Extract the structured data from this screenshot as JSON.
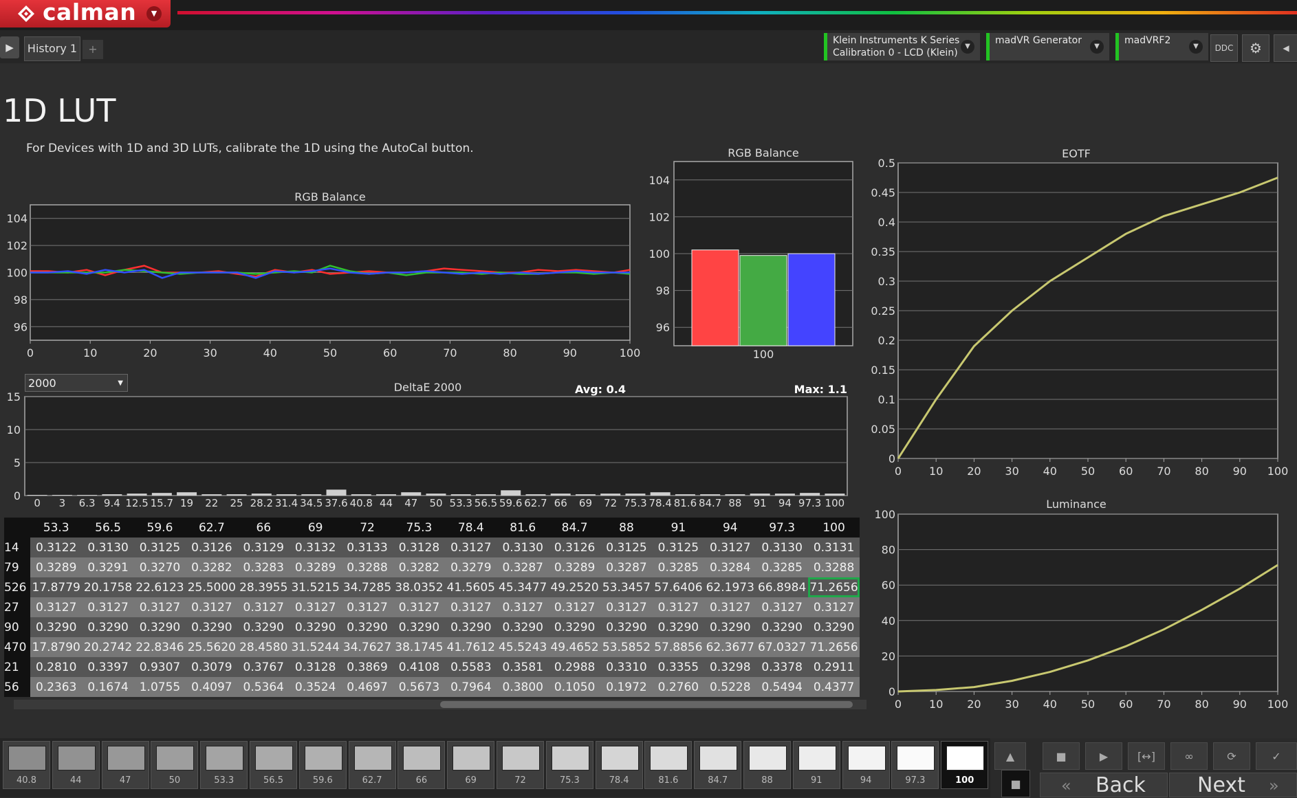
{
  "app": {
    "name": "calman",
    "history_tab": "History 1",
    "add_tab": "+",
    "devices": [
      {
        "line1": "Klein Instruments K Series",
        "line2": "Calibration 0 - LCD (Klein)"
      },
      {
        "line1": "madVR Generator",
        "line2": ""
      },
      {
        "line1": "madVRF2",
        "line2": ""
      }
    ],
    "ddc_label": "DDC"
  },
  "page": {
    "title": "1D LUT",
    "subtitle": "For Devices with 1D and 3D LUTs, calibrate the 1D using the AutoCal button."
  },
  "colors": {
    "accent": "#22c322",
    "red": "#ff4444",
    "green": "#44aa44",
    "blue": "#4444ff",
    "curve": "#c8c870"
  },
  "chart_data": [
    {
      "type": "line",
      "title": "RGB Balance",
      "x": [
        0,
        3,
        6.3,
        9.4,
        12.5,
        15.7,
        19,
        22,
        25,
        28.2,
        31.4,
        34.5,
        37.6,
        40.8,
        44,
        47,
        50,
        53.3,
        56.5,
        59.6,
        62.7,
        66,
        69,
        72,
        75.3,
        78.4,
        81.6,
        84.7,
        88,
        91,
        94,
        97.3,
        100
      ],
      "series": [
        {
          "name": "Red",
          "color": "#ff3030",
          "values": [
            100.1,
            100.1,
            100.0,
            100.2,
            99.8,
            100.2,
            100.5,
            100.0,
            100.0,
            100.0,
            100.1,
            99.9,
            99.7,
            100.2,
            100.0,
            100.2,
            99.9,
            100.0,
            100.1,
            100.0,
            100.0,
            100.1,
            100.3,
            100.2,
            100.1,
            100.0,
            100.0,
            100.2,
            100.1,
            100.2,
            100.1,
            100.0,
            100.2
          ]
        },
        {
          "name": "Green",
          "color": "#30c030",
          "values": [
            100.0,
            100.0,
            100.0,
            100.0,
            100.0,
            100.2,
            100.1,
            100.0,
            99.9,
            100.0,
            100.0,
            100.0,
            99.9,
            100.0,
            100.1,
            100.0,
            100.5,
            100.1,
            99.9,
            100.0,
            99.8,
            100.0,
            100.0,
            100.0,
            99.9,
            100.0,
            99.9,
            99.9,
            100.0,
            100.0,
            99.9,
            100.0,
            99.9
          ]
        },
        {
          "name": "Blue",
          "color": "#3050ff",
          "values": [
            100.0,
            100.0,
            100.1,
            99.9,
            100.2,
            100.0,
            100.2,
            99.6,
            100.0,
            100.0,
            100.0,
            100.0,
            99.6,
            100.1,
            100.0,
            100.1,
            100.3,
            100.0,
            99.9,
            100.0,
            100.0,
            100.1,
            100.0,
            99.9,
            100.0,
            99.9,
            100.0,
            99.9,
            100.0,
            100.1,
            100.0,
            100.0,
            100.0
          ]
        }
      ],
      "ylim": [
        95,
        105
      ],
      "yticks": [
        96,
        98,
        100,
        102,
        104
      ],
      "xlim": [
        0,
        100
      ],
      "xticks": [
        0,
        10,
        20,
        30,
        40,
        50,
        60,
        70,
        80,
        90,
        100
      ]
    },
    {
      "type": "bar",
      "title": "RGB Balance",
      "categories": [
        "100"
      ],
      "series": [
        {
          "name": "Red",
          "color": "#ff4444",
          "values": [
            100.2
          ]
        },
        {
          "name": "Green",
          "color": "#44aa44",
          "values": [
            99.9
          ]
        },
        {
          "name": "Blue",
          "color": "#4444ff",
          "values": [
            100.0
          ]
        }
      ],
      "ylim": [
        95,
        105
      ],
      "yticks": [
        96,
        98,
        100,
        102,
        104
      ]
    },
    {
      "type": "bar",
      "title": "DeltaE 2000",
      "avg_label": "Avg: 0.4",
      "max_label": "Max: 1.1",
      "categories": [
        "0",
        "3",
        "6.3",
        "9.4",
        "12.5",
        "15.7",
        "19",
        "22",
        "25",
        "28.2",
        "31.4",
        "34.5",
        "37.6",
        "40.8",
        "44",
        "47",
        "50",
        "53.3",
        "56.5",
        "59.6",
        "62.7",
        "66",
        "69",
        "72",
        "75.3",
        "78.4",
        "81.6",
        "84.7",
        "88",
        "91",
        "94",
        "97.3",
        "100"
      ],
      "values": [
        0.1,
        0.1,
        0.1,
        0.2,
        0.3,
        0.4,
        0.5,
        0.2,
        0.2,
        0.3,
        0.2,
        0.2,
        0.9,
        0.2,
        0.2,
        0.5,
        0.3,
        0.2,
        0.2,
        0.8,
        0.2,
        0.3,
        0.2,
        0.3,
        0.3,
        0.5,
        0.2,
        0.2,
        0.2,
        0.3,
        0.3,
        0.4,
        0.3
      ],
      "ylim": [
        0,
        15
      ],
      "yticks": [
        0,
        5,
        10,
        15
      ],
      "selector": "2000"
    },
    {
      "type": "line",
      "title": "EOTF",
      "x": [
        0,
        10,
        20,
        30,
        40,
        50,
        60,
        70,
        80,
        90,
        100
      ],
      "series": [
        {
          "name": "EOTF",
          "values": [
            0.0,
            0.1,
            0.19,
            0.25,
            0.3,
            0.34,
            0.38,
            0.41,
            0.43,
            0.45,
            0.475
          ]
        }
      ],
      "xlim": [
        0,
        100
      ],
      "ylim": [
        0,
        0.5
      ],
      "yticks": [
        "0",
        "0.05",
        "0.1",
        "0.15",
        "0.2",
        "0.25",
        "0.3",
        "0.35",
        "0.4",
        "0.45",
        "0.5"
      ],
      "xticks": [
        0,
        10,
        20,
        30,
        40,
        50,
        60,
        70,
        80,
        90,
        100
      ]
    },
    {
      "type": "line",
      "title": "Luminance",
      "x": [
        0,
        10,
        20,
        30,
        40,
        50,
        60,
        70,
        80,
        90,
        100
      ],
      "series": [
        {
          "name": "Luminance",
          "values": [
            0.0,
            0.8,
            2.5,
            6.0,
            11.0,
            17.5,
            25.5,
            35.0,
            46.0,
            58.0,
            71.3
          ]
        }
      ],
      "xlim": [
        0,
        100
      ],
      "ylim": [
        0,
        100
      ],
      "yticks": [
        0,
        20,
        40,
        60,
        80,
        100
      ],
      "xticks": [
        0,
        10,
        20,
        30,
        40,
        50,
        60,
        70,
        80,
        90,
        100
      ]
    }
  ],
  "table": {
    "header": [
      "",
      "53.3",
      "56.5",
      "59.6",
      "62.7",
      "66",
      "69",
      "72",
      "75.3",
      "78.4",
      "81.6",
      "84.7",
      "88",
      "91",
      "94",
      "97.3",
      "100"
    ],
    "rows": [
      [
        "14",
        "0.3122",
        "0.3130",
        "0.3125",
        "0.3126",
        "0.3129",
        "0.3132",
        "0.3133",
        "0.3128",
        "0.3127",
        "0.3130",
        "0.3126",
        "0.3125",
        "0.3125",
        "0.3127",
        "0.3130",
        "0.3131"
      ],
      [
        "79",
        "0.3289",
        "0.3291",
        "0.3270",
        "0.3282",
        "0.3283",
        "0.3289",
        "0.3288",
        "0.3282",
        "0.3279",
        "0.3287",
        "0.3289",
        "0.3287",
        "0.3285",
        "0.3284",
        "0.3285",
        "0.3288"
      ],
      [
        "526",
        "17.8779",
        "20.1758",
        "22.6123",
        "25.5000",
        "28.3955",
        "31.5215",
        "34.7285",
        "38.0352",
        "41.5605",
        "45.3477",
        "49.2520",
        "53.3457",
        "57.6406",
        "62.1973",
        "66.8984",
        "71.2656"
      ],
      [
        "27",
        "0.3127",
        "0.3127",
        "0.3127",
        "0.3127",
        "0.3127",
        "0.3127",
        "0.3127",
        "0.3127",
        "0.3127",
        "0.3127",
        "0.3127",
        "0.3127",
        "0.3127",
        "0.3127",
        "0.3127",
        "0.3127"
      ],
      [
        "90",
        "0.3290",
        "0.3290",
        "0.3290",
        "0.3290",
        "0.3290",
        "0.3290",
        "0.3290",
        "0.3290",
        "0.3290",
        "0.3290",
        "0.3290",
        "0.3290",
        "0.3290",
        "0.3290",
        "0.3290",
        "0.3290"
      ],
      [
        "470",
        "17.8790",
        "20.2742",
        "22.8346",
        "25.5620",
        "28.4580",
        "31.5244",
        "34.7627",
        "38.1745",
        "41.7612",
        "45.5243",
        "49.4652",
        "53.5852",
        "57.8856",
        "62.3677",
        "67.0327",
        "71.2656"
      ],
      [
        "21",
        "0.2810",
        "0.3397",
        "0.9307",
        "0.3079",
        "0.3767",
        "0.3128",
        "0.3869",
        "0.4108",
        "0.5583",
        "0.3581",
        "0.2988",
        "0.3310",
        "0.3355",
        "0.3298",
        "0.3378",
        "0.2911"
      ],
      [
        "56",
        "0.2363",
        "0.1674",
        "1.0755",
        "0.4097",
        "0.5364",
        "0.3524",
        "0.4697",
        "0.5673",
        "0.7964",
        "0.3800",
        "0.1050",
        "0.1972",
        "0.2760",
        "0.5228",
        "0.5494",
        "0.4377"
      ]
    ]
  },
  "swatches": [
    {
      "label": "40.8",
      "level": 40.8
    },
    {
      "label": "44",
      "level": 44
    },
    {
      "label": "47",
      "level": 47
    },
    {
      "label": "50",
      "level": 50
    },
    {
      "label": "53.3",
      "level": 53.3
    },
    {
      "label": "56.5",
      "level": 56.5
    },
    {
      "label": "59.6",
      "level": 59.6
    },
    {
      "label": "62.7",
      "level": 62.7
    },
    {
      "label": "66",
      "level": 66
    },
    {
      "label": "69",
      "level": 69
    },
    {
      "label": "72",
      "level": 72
    },
    {
      "label": "75.3",
      "level": 75.3
    },
    {
      "label": "78.4",
      "level": 78.4
    },
    {
      "label": "81.6",
      "level": 81.6
    },
    {
      "label": "84.7",
      "level": 84.7
    },
    {
      "label": "88",
      "level": 88
    },
    {
      "label": "91",
      "level": 91
    },
    {
      "label": "94",
      "level": 94
    },
    {
      "label": "97.3",
      "level": 97.3
    },
    {
      "label": "100",
      "level": 100,
      "active": true
    }
  ],
  "nav": {
    "back": "Back",
    "next": "Next"
  }
}
